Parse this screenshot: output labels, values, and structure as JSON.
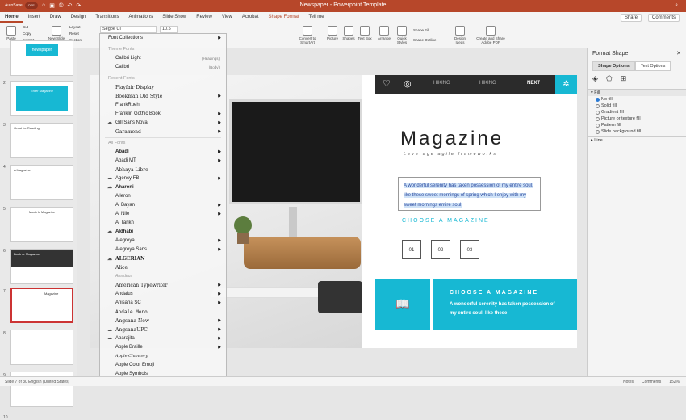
{
  "titlebar": {
    "autosave": "AutoSave",
    "autosave_state": "OFF",
    "title": "Newspaper - Powerpoint Template"
  },
  "tabs": [
    "Home",
    "Insert",
    "Draw",
    "Design",
    "Transitions",
    "Animations",
    "Slide Show",
    "Review",
    "View",
    "Acrobat",
    "Shape Format",
    "Tell me"
  ],
  "tabs_right": {
    "share": "Share",
    "comments": "Comments"
  },
  "ribbon": {
    "paste": "Paste",
    "cut": "Cut",
    "copy": "Copy",
    "format": "Format",
    "new_slide": "New Slide",
    "layout": "Layout",
    "reset": "Reset",
    "section": "Section",
    "font_name": "Segoe UI",
    "font_size": "10.5",
    "convert": "Convert to SmartArt",
    "picture": "Picture",
    "shapes": "Shapes",
    "textbox": "Text Box",
    "arrange": "Arrange",
    "quick_styles": "Quick Styles",
    "shape_fill": "Shape Fill",
    "shape_outline": "Shape Outline",
    "design_ideas": "Design Ideas",
    "create_share": "Create and Share Adobe PDF"
  },
  "fontmenu": {
    "font_collections": "Font Collections",
    "theme_fonts_hdr": "Theme Fonts",
    "theme_fonts": [
      {
        "name": "Calibri Light",
        "tag": "(Headings)"
      },
      {
        "name": "Calibri",
        "tag": "(Body)"
      }
    ],
    "recent_hdr": "Recent Fonts",
    "recent": [
      "Playfair Display",
      "Bookman Old Style",
      "FrankRuehl",
      "Franklin Gothic Book",
      "Gill Sans Nova",
      "Garamond"
    ],
    "all_hdr": "All Fonts",
    "all": [
      "Abadi",
      "Abadi MT",
      "Abhaya Libre",
      "Agency FB",
      "Aharoni",
      "Aileron",
      "Al Bayan",
      "Al Nile",
      "Al Tarikh",
      "Aldhabi",
      "Alegreya",
      "Alegreya Sans",
      "ALGERIAN",
      "Alice",
      "Amadeus",
      "American Typewriter",
      "Andalus",
      "Anisana SC",
      "Andale Mono",
      "Angsana New",
      "AngsanaUPC",
      "Aparajita",
      "Apple Braille",
      "Apple Chancery",
      "Apple Color Emoji",
      "Apple Symbols"
    ]
  },
  "slide": {
    "nav": [
      "HIKING",
      "HIKING",
      "NEXT"
    ],
    "title": "Magazine",
    "subtitle": "Leverage agile frameworks",
    "body_line1": "A wonderful serenity has taken possession of my entire soul,",
    "body_line2": "like these sweet mornings of spring which I enjoy with my",
    "body_line3": "sweet mornings entire soul.",
    "choose": "CHOOSE A MAGAZINE",
    "boxes": [
      "01",
      "02",
      "03"
    ],
    "cyan_heading": "CHOOSE A MAGAZINE",
    "cyan_text": "A wonderful serenity has taken possession of my entire soul, like these"
  },
  "thumbs": [
    {
      "num": "",
      "title": "newspaper"
    },
    {
      "num": "2",
      "title": "Enter Magazine"
    },
    {
      "num": "3",
      "title": "Great for Reading"
    },
    {
      "num": "4",
      "title": "A Magazine"
    },
    {
      "num": "5",
      "title": "Much Is Magazine"
    },
    {
      "num": "6",
      "title": "Book or Magazine"
    },
    {
      "num": "7",
      "title": "Magazine"
    },
    {
      "num": "8",
      "title": ""
    },
    {
      "num": "9",
      "title": "The Newspaper"
    },
    {
      "num": "10",
      "title": ""
    }
  ],
  "pane": {
    "title": "Format Shape",
    "tab1": "Shape Options",
    "tab2": "Text Options",
    "fill": "Fill",
    "options": [
      "No fill",
      "Solid fill",
      "Gradient fill",
      "Picture or texture fill",
      "Pattern fill",
      "Slide background fill"
    ],
    "line": "Line"
  },
  "status": {
    "left": "Slide 7 of 30    English (United States)",
    "notes": "Notes",
    "comments": "Comments",
    "zoom": "152%"
  },
  "colors": {
    "accent": "#b7472a",
    "cyan": "#17b8d3"
  }
}
